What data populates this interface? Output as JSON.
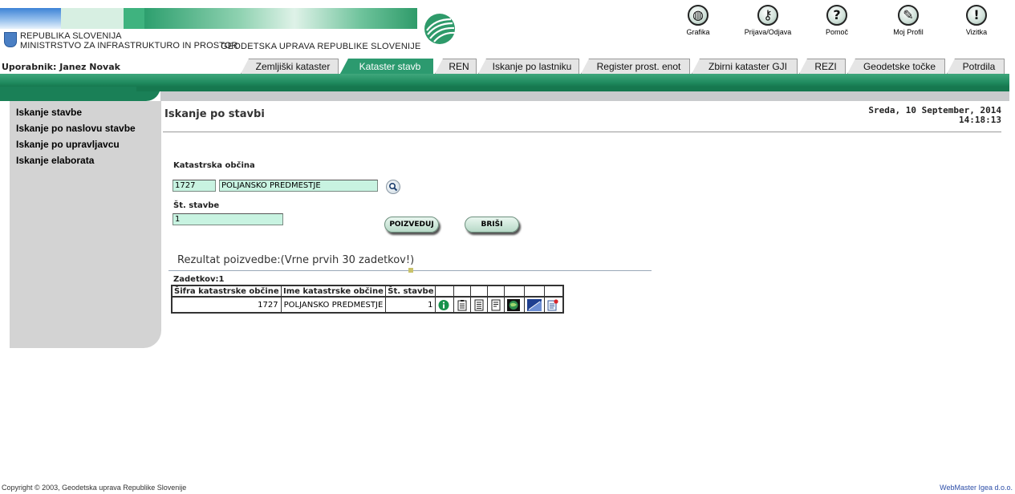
{
  "header": {
    "org_line1": "REPUBLIKA SLOVENIJA",
    "org_line2": "MINISTRSTVO ZA INFRASTRUKTURO IN PROSTOR",
    "org_name": "GEODETSKA UPRAVA REPUBLIKE SLOVENIJE",
    "icons": [
      {
        "label": "Grafika",
        "icon": "globe-icon"
      },
      {
        "label": "Prijava/Odjava",
        "icon": "key-icon"
      },
      {
        "label": "Pomoč",
        "icon": "help-icon"
      },
      {
        "label": "Moj Profil",
        "icon": "profile-icon"
      },
      {
        "label": "Vizitka",
        "icon": "info-exclamation-icon"
      }
    ]
  },
  "user": "Uporabnik: Janez Novak",
  "tabs": [
    "Zemljiški kataster",
    "Kataster stavb",
    "REN",
    "Iskanje po lastniku",
    "Register prost. enot",
    "Zbirni kataster GJI",
    "REZI",
    "Geodetske točke",
    "Potrdila"
  ],
  "active_tab": "Kataster stavb",
  "sidebar": [
    "Iskanje stavbe",
    "Iskanje po naslovu stavbe",
    "Iskanje po upravljavcu",
    "Iskanje elaborata"
  ],
  "main": {
    "title": "Iskanje po stavbi",
    "date_line1": "Sreda, 10 September, 2014",
    "date_line2": "14:18:13",
    "ko_label": "Katastrska občina",
    "ko_code": "1727",
    "ko_name": "POLJANSKO PREDMESTJE",
    "st_label": "Št. stavbe",
    "st_value": "1",
    "btn_query": "POIZVEDUJ",
    "btn_clear": "BRIŠI",
    "result_title": "Rezultat poizvedbe:(Vrne prvih 30 zadetkov!)",
    "count": "Zadetkov:1",
    "columns": [
      "Šifra katastrske občine",
      "Ime katastrske občine",
      "Št. stavbe"
    ],
    "rows": [
      {
        "code": "1727",
        "name": "POLJANSKO PREDMESTJE",
        "st": "1"
      }
    ]
  },
  "footer": {
    "left": "Copyright © 2003, Geodetska uprava Republike Slovenije",
    "right": "WebMaster Igea d.o.o."
  }
}
